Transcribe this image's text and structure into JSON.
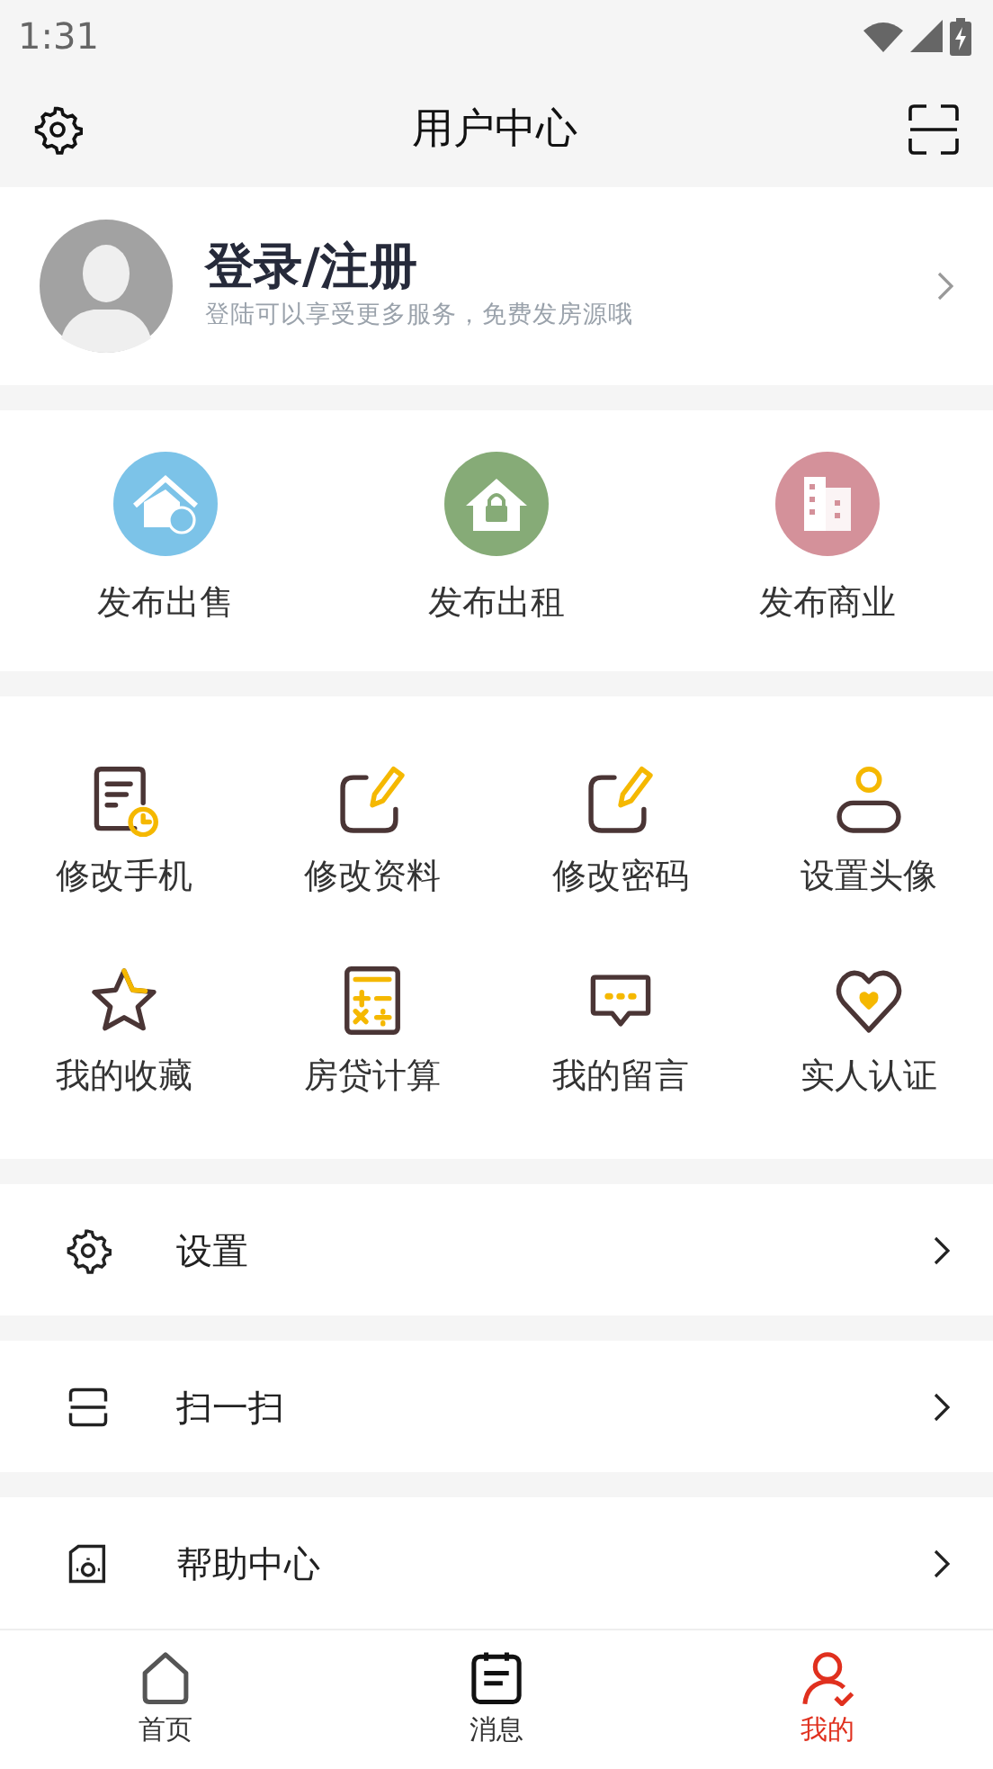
{
  "status_bar": {
    "time": "1:31"
  },
  "header": {
    "title": "用户中心"
  },
  "profile": {
    "name": "登录/注册",
    "subtitle": "登陆可以享受更多服务，免费发房源哦"
  },
  "publish": [
    {
      "label": "发布出售",
      "color": "#7cc3e8"
    },
    {
      "label": "发布出租",
      "color": "#86ab77"
    },
    {
      "label": "发布商业",
      "color": "#d4919a"
    }
  ],
  "tools": [
    {
      "label": "修改手机"
    },
    {
      "label": "修改资料"
    },
    {
      "label": "修改密码"
    },
    {
      "label": "设置头像"
    },
    {
      "label": "我的收藏"
    },
    {
      "label": "房贷计算"
    },
    {
      "label": "我的留言"
    },
    {
      "label": "实人认证"
    }
  ],
  "menu": [
    {
      "label": "设置"
    },
    {
      "label": "扫一扫"
    },
    {
      "label": "帮助中心"
    }
  ],
  "tab_bar": [
    {
      "label": "首页",
      "selected": false
    },
    {
      "label": "消息",
      "selected": false
    },
    {
      "label": "我的",
      "selected": true
    }
  ]
}
